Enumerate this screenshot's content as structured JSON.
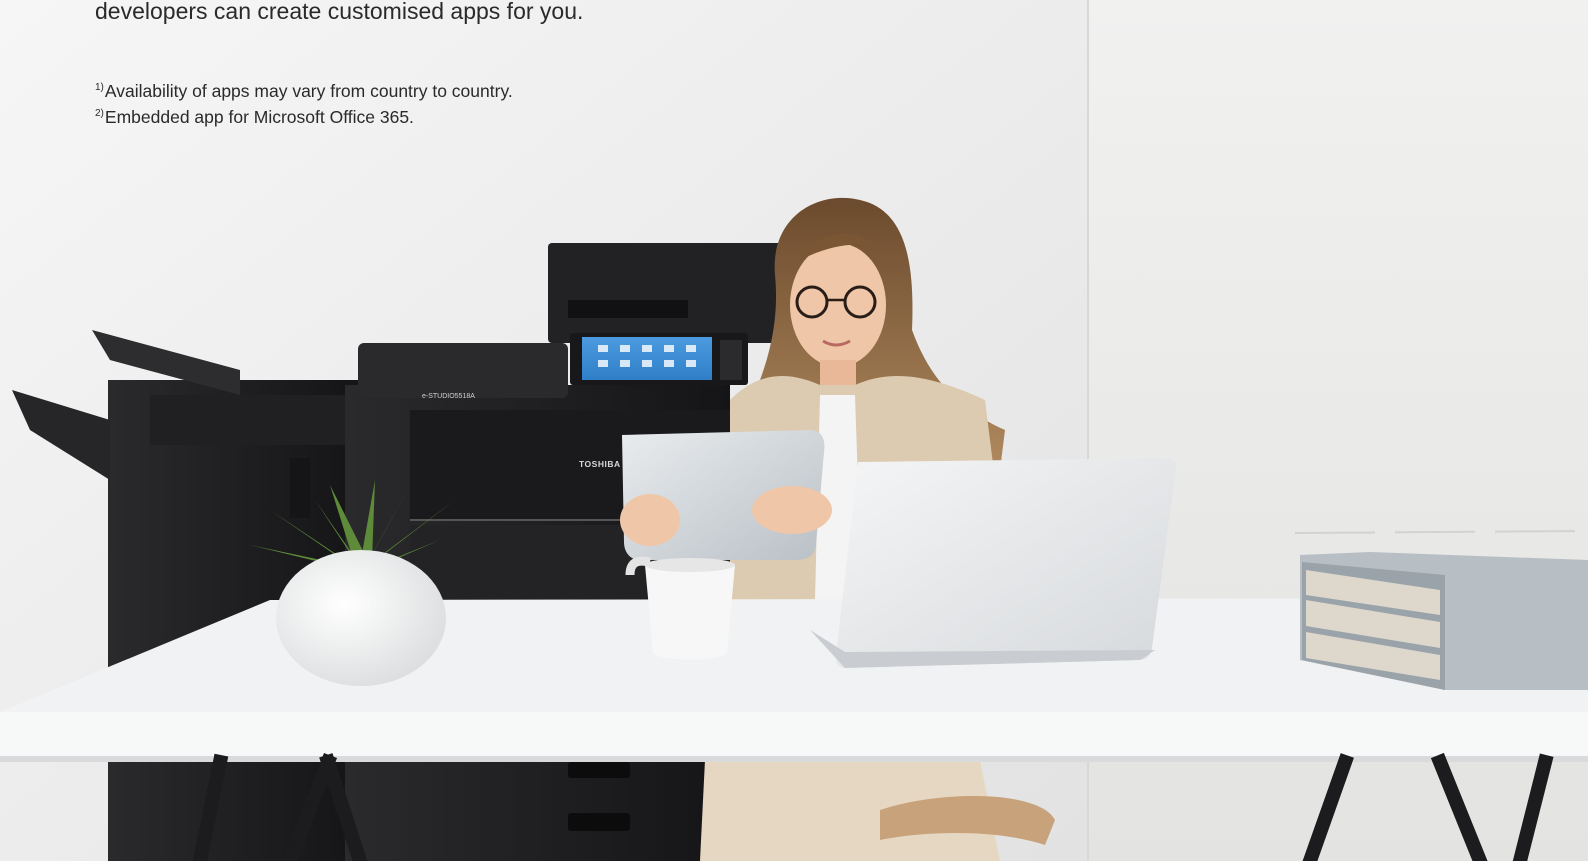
{
  "intro": {
    "line": "developers can create customised apps for you."
  },
  "footnotes": [
    {
      "mark": "1)",
      "text": "Availability of apps may vary from country to country."
    },
    {
      "mark": "2)",
      "text": "Embedded app for Microsoft Office 365."
    }
  ],
  "photo": {
    "printer_brand": "TOSHIBA",
    "printer_model": "e-STUDIO5518A"
  },
  "colors": {
    "wall": "#ececec",
    "wall_right": "#e4e4e2",
    "desk": "#f2f3f3",
    "printer": "#1f1f21",
    "screen": "#3d8fd6"
  }
}
